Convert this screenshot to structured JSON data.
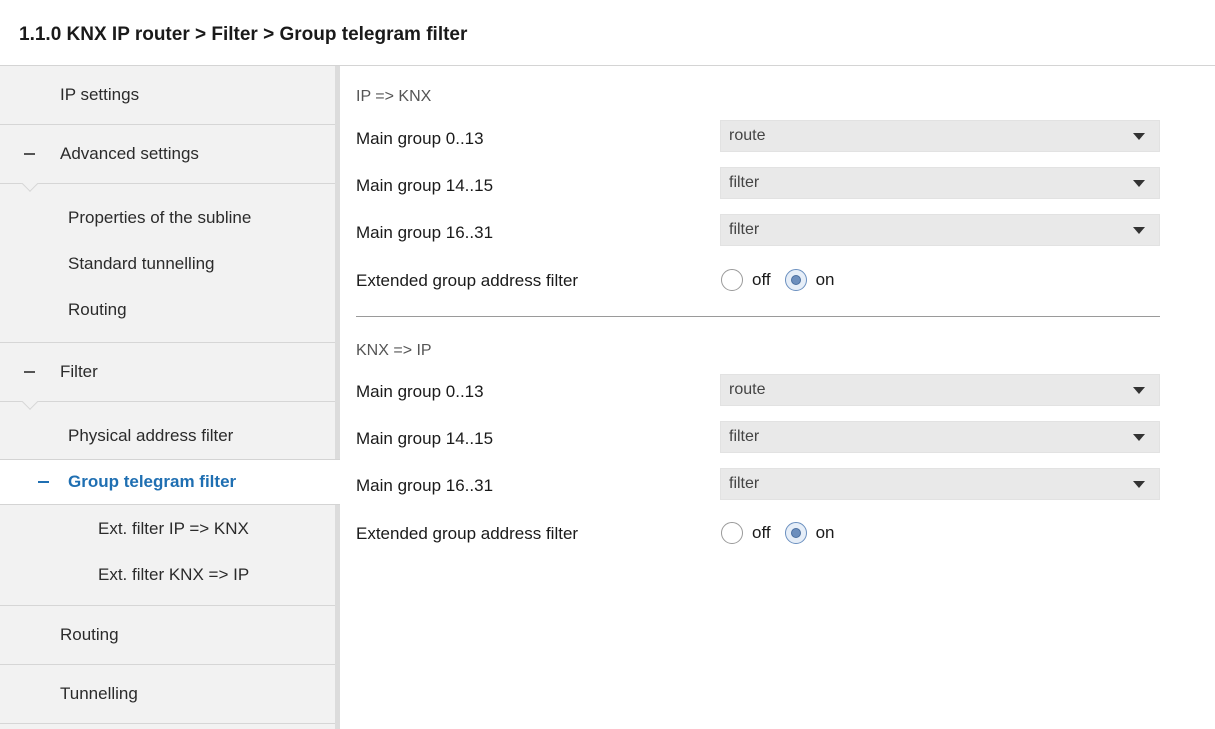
{
  "header": {
    "title": "1.1.0 KNX IP router > Filter > Group telegram filter"
  },
  "sidebar": {
    "ip_settings": "IP settings",
    "advanced_settings": "Advanced settings",
    "properties_subline": "Properties of the subline",
    "standard_tunnelling": "Standard tunnelling",
    "routing_sub": "Routing",
    "filter": "Filter",
    "physical_address_filter": "Physical address filter",
    "group_telegram_filter": "Group telegram filter",
    "ext_filter_ip_knx": "Ext. filter IP => KNX",
    "ext_filter_knx_ip": "Ext. filter KNX => IP",
    "routing": "Routing",
    "tunnelling": "Tunnelling"
  },
  "ip_to_knx": {
    "heading": "IP => KNX",
    "main_group_0_13": {
      "label": "Main group 0..13",
      "value": "route"
    },
    "main_group_14_15": {
      "label": "Main group 14..15",
      "value": "filter"
    },
    "main_group_16_31": {
      "label": "Main group 16..31",
      "value": "filter"
    },
    "extended_filter": {
      "label": "Extended group address filter",
      "off": "off",
      "on": "on",
      "selected": "on"
    }
  },
  "knx_to_ip": {
    "heading": "KNX => IP",
    "main_group_0_13": {
      "label": "Main group 0..13",
      "value": "route"
    },
    "main_group_14_15": {
      "label": "Main group 14..15",
      "value": "filter"
    },
    "main_group_16_31": {
      "label": "Main group 16..31",
      "value": "filter"
    },
    "extended_filter": {
      "label": "Extended group address filter",
      "off": "off",
      "on": "on",
      "selected": "on"
    }
  },
  "colors": {
    "accent": "#1f6fb2",
    "sidebar_bg": "#f2f2f2",
    "dropdown_bg": "#e9e9e9"
  }
}
